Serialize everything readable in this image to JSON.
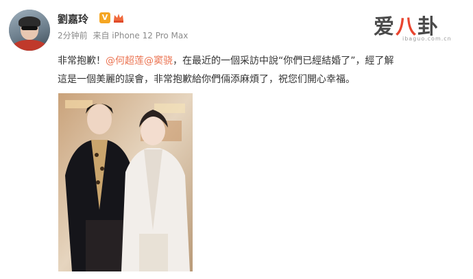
{
  "post": {
    "username": "劉嘉玲",
    "verified_badge": "V",
    "timestamp": "2分钟前",
    "source": "来自 iPhone 12 Pro Max",
    "text_before": "非常抱歉！",
    "mentions": [
      "@何超莲",
      "@窦骁"
    ],
    "text_line1_after": "，在最近的一個采訪中說“你們已經結婚了”，經了解",
    "text_line2": "這是一個美麗的誤會，非常抱歉給你們倆添麻煩了，祝您们開心幸福。"
  },
  "watermark": {
    "logo_text_1": "爱",
    "logo_text_2": "八",
    "logo_text_3": "卦",
    "url": "ibaguo.com.cn"
  },
  "colors": {
    "mention": "#eb7350",
    "badge": "#f5a623",
    "meta": "#8b8b8b"
  },
  "icons": [
    "avatar",
    "verified-badge-icon",
    "crown-icon",
    "post-photo"
  ]
}
